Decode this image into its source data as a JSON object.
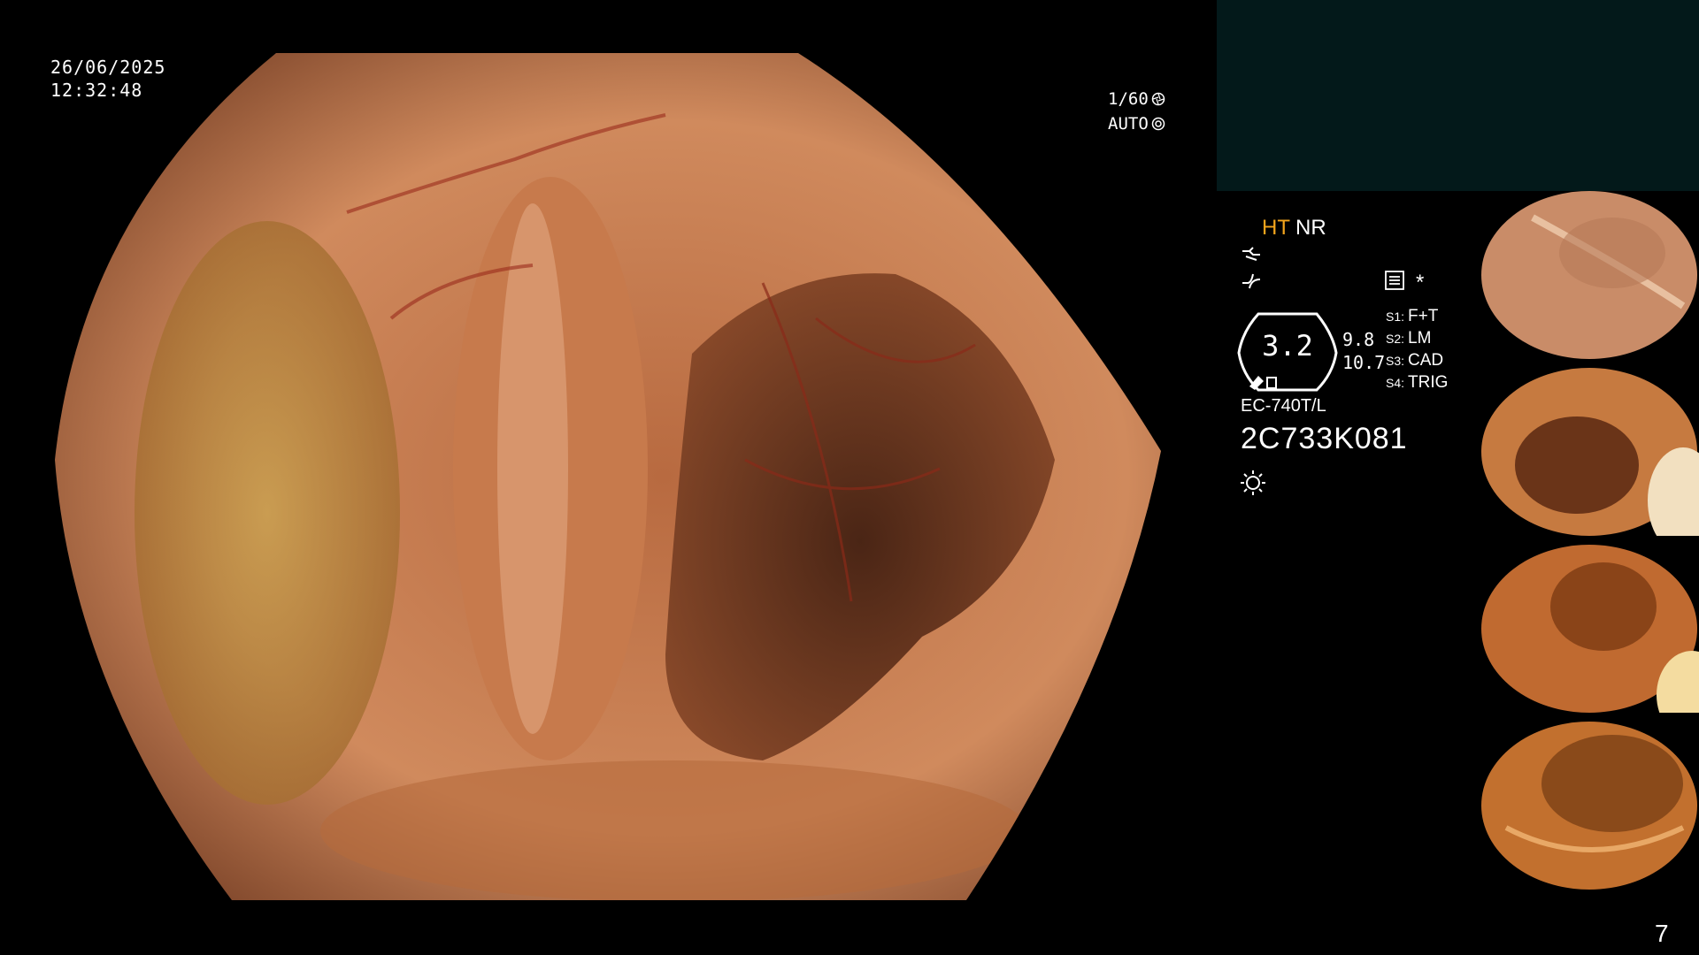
{
  "overlay": {
    "date": "26/06/2025",
    "time": "12:32:48",
    "shutter": "1/60",
    "iris": "AUTO"
  },
  "panel": {
    "ht": "HT",
    "nr": "NR",
    "zoom_value": "3.2",
    "value_a": "9.8",
    "value_b": "10.7",
    "asterisk": "*",
    "switches": [
      {
        "key": "S1:",
        "value": "F+T"
      },
      {
        "key": "S2:",
        "value": "LM"
      },
      {
        "key": "S3:",
        "value": "CAD"
      },
      {
        "key": "S4:",
        "value": "TRIG"
      }
    ],
    "model": "EC-740T/L",
    "serial": "2C733K081",
    "page_number": "7"
  },
  "colors": {
    "ht_accent": "#f3a41c",
    "info_box": "#03191a",
    "mucosa": "#c97a4e",
    "lumen": "#4a2515"
  },
  "icons": [
    "shutter-icon",
    "iris-icon",
    "tip-icon",
    "scope-curve-icon",
    "list-icon",
    "light-icon"
  ]
}
